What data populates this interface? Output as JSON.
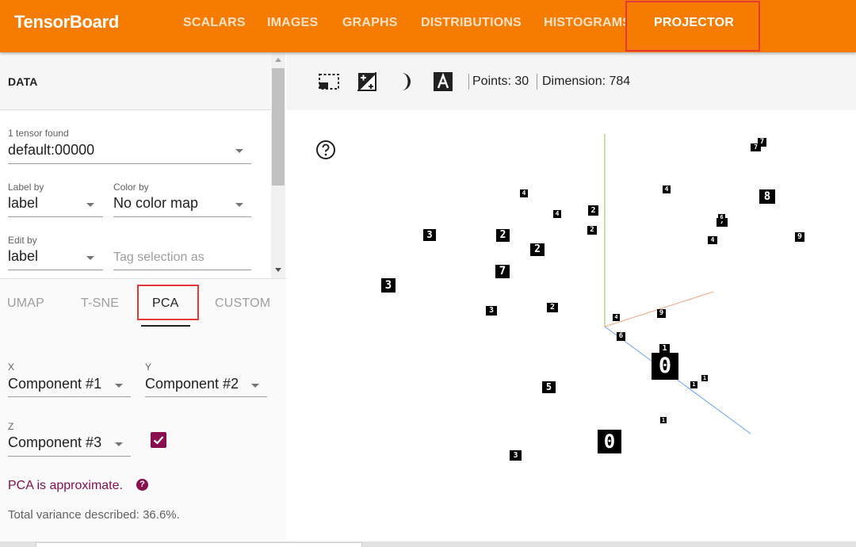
{
  "app": {
    "title": "TensorBoard",
    "nav_tabs": [
      "SCALARS",
      "IMAGES",
      "GRAPHS",
      "DISTRIBUTIONS",
      "HISTOGRAMS",
      "PROJECTOR"
    ],
    "active_tab": "PROJECTOR",
    "accent_color": "#f57c00"
  },
  "data_panel": {
    "header": "DATA",
    "tensor": {
      "label": "1 tensor found",
      "value": "default:00000"
    },
    "label_by": {
      "label": "Label by",
      "value": "label"
    },
    "color_by": {
      "label": "Color by",
      "value": "No color map"
    },
    "edit_by": {
      "label": "Edit by",
      "value": "label"
    },
    "tag_selection": {
      "placeholder": "Tag selection as"
    }
  },
  "projection": {
    "tabs": [
      "UMAP",
      "T-SNE",
      "PCA",
      "CUSTOM"
    ],
    "active_tab": "PCA",
    "x": {
      "label": "X",
      "value": "Component #1"
    },
    "y": {
      "label": "Y",
      "value": "Component #2"
    },
    "z": {
      "label": "Z",
      "value": "Component #3",
      "checked": true
    },
    "approx_text": "PCA is approximate.",
    "variance_text": "Total variance described: 36.6%.",
    "accent_color": "#880e4f"
  },
  "toolbar": {
    "icons": [
      "select-region-icon",
      "night-mode-icon",
      "moon-icon",
      "label-icon"
    ],
    "points_text": "Points: 30",
    "dimension_text": "Dimension: 784"
  },
  "scene": {
    "axis_colors": {
      "x": "#f4a582",
      "y": "#8bc34a",
      "z": "#64a0ff"
    },
    "points": [
      {
        "d": "7"
      },
      {
        "d": "7"
      },
      {
        "d": "8"
      },
      {
        "d": "4"
      },
      {
        "d": "4"
      },
      {
        "d": "4"
      },
      {
        "d": "2"
      },
      {
        "d": "2"
      },
      {
        "d": "7"
      },
      {
        "d": "6"
      },
      {
        "d": "9"
      },
      {
        "d": "4"
      },
      {
        "d": "3"
      },
      {
        "d": "2"
      },
      {
        "d": "3"
      },
      {
        "d": "2"
      },
      {
        "d": "3"
      },
      {
        "d": "2"
      },
      {
        "d": "4"
      },
      {
        "d": "9"
      },
      {
        "d": "6"
      },
      {
        "d": "1"
      },
      {
        "d": "0"
      },
      {
        "d": "1"
      },
      {
        "d": "1"
      },
      {
        "d": "5"
      },
      {
        "d": "1"
      },
      {
        "d": "0"
      },
      {
        "d": "3"
      },
      {
        "d": "7"
      }
    ]
  }
}
